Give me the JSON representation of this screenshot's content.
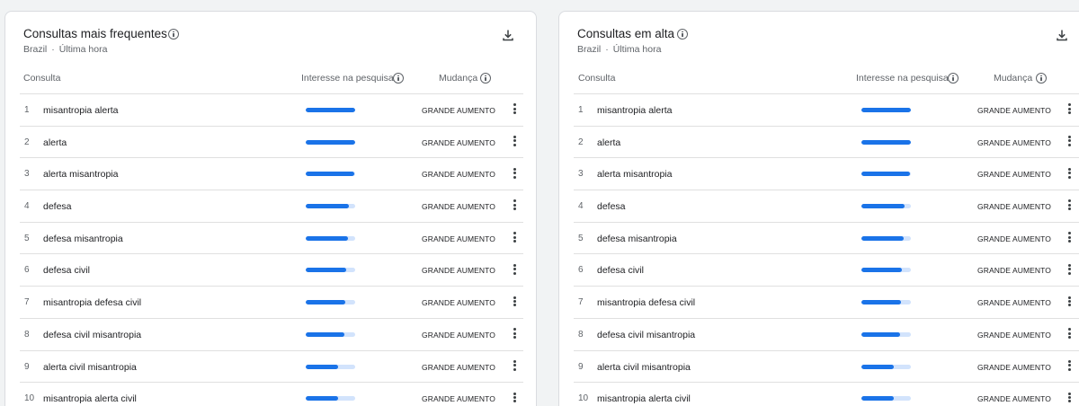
{
  "panels": [
    {
      "title": "Consultas mais frequentes",
      "region": "Brazil",
      "period": "Última hora",
      "columns": {
        "query": "Consulta",
        "interest": "Interesse na pesquisa",
        "change": "Mudança"
      },
      "rows": [
        {
          "rank": "1",
          "query": "misantropia alerta",
          "interest": 100,
          "change": "GRANDE AUMENTO"
        },
        {
          "rank": "2",
          "query": "alerta",
          "interest": 100,
          "change": "GRANDE AUMENTO"
        },
        {
          "rank": "3",
          "query": "alerta misantropia",
          "interest": 98,
          "change": "GRANDE AUMENTO"
        },
        {
          "rank": "4",
          "query": "defesa",
          "interest": 87,
          "change": "GRANDE AUMENTO"
        },
        {
          "rank": "5",
          "query": "defesa misantropia",
          "interest": 85,
          "change": "GRANDE AUMENTO"
        },
        {
          "rank": "6",
          "query": "defesa civil",
          "interest": 82,
          "change": "GRANDE AUMENTO"
        },
        {
          "rank": "7",
          "query": "misantropia defesa civil",
          "interest": 80,
          "change": "GRANDE AUMENTO"
        },
        {
          "rank": "8",
          "query": "defesa civil misantropia",
          "interest": 78,
          "change": "GRANDE AUMENTO"
        },
        {
          "rank": "9",
          "query": "alerta civil misantropia",
          "interest": 65,
          "change": "GRANDE AUMENTO"
        },
        {
          "rank": "10",
          "query": "misantropia alerta civil",
          "interest": 65,
          "change": "GRANDE AUMENTO"
        }
      ]
    },
    {
      "title": "Consultas em alta",
      "region": "Brazil",
      "period": "Última hora",
      "columns": {
        "query": "Consulta",
        "interest": "Interesse na pesquisa",
        "change": "Mudança"
      },
      "rows": [
        {
          "rank": "1",
          "query": "misantropia alerta",
          "interest": 100,
          "change": "GRANDE AUMENTO"
        },
        {
          "rank": "2",
          "query": "alerta",
          "interest": 100,
          "change": "GRANDE AUMENTO"
        },
        {
          "rank": "3",
          "query": "alerta misantropia",
          "interest": 98,
          "change": "GRANDE AUMENTO"
        },
        {
          "rank": "4",
          "query": "defesa",
          "interest": 87,
          "change": "GRANDE AUMENTO"
        },
        {
          "rank": "5",
          "query": "defesa misantropia",
          "interest": 85,
          "change": "GRANDE AUMENTO"
        },
        {
          "rank": "6",
          "query": "defesa civil",
          "interest": 82,
          "change": "GRANDE AUMENTO"
        },
        {
          "rank": "7",
          "query": "misantropia defesa civil",
          "interest": 80,
          "change": "GRANDE AUMENTO"
        },
        {
          "rank": "8",
          "query": "defesa civil misantropia",
          "interest": 78,
          "change": "GRANDE AUMENTO"
        },
        {
          "rank": "9",
          "query": "alerta civil misantropia",
          "interest": 65,
          "change": "GRANDE AUMENTO"
        },
        {
          "rank": "10",
          "query": "misantropia alerta civil",
          "interest": 65,
          "change": "GRANDE AUMENTO"
        }
      ]
    }
  ],
  "colors": {
    "bar_fill": "#1a73e8",
    "bar_track": "#d2e3fc",
    "divider": "#e0e0e0"
  },
  "icons": {
    "info": "info-icon",
    "download": "download-icon",
    "more": "more-vert-icon"
  }
}
